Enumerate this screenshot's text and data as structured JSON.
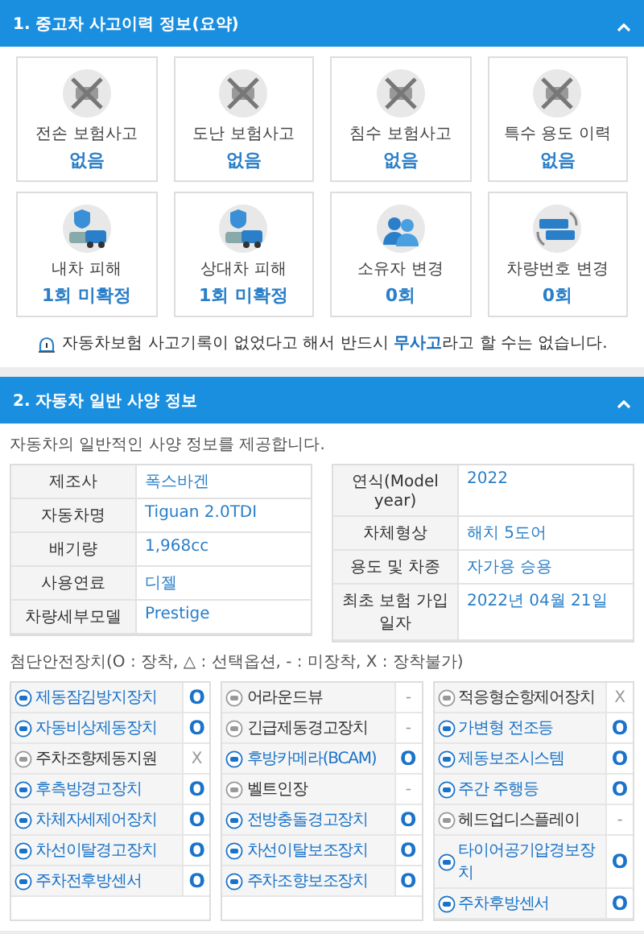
{
  "history": {
    "title": "1. 중고차 사고이력 정보(요약)",
    "expanded": true,
    "cards": [
      {
        "label": "전손 보험사고",
        "value": "없음",
        "kind": "none"
      },
      {
        "label": "도난 보험사고",
        "value": "없음",
        "kind": "none"
      },
      {
        "label": "침수 보험사고",
        "value": "없음",
        "kind": "none"
      },
      {
        "label": "특수 용도 이력",
        "value": "없음",
        "kind": "none"
      },
      {
        "label": "내차 피해",
        "value": "1회 미확정",
        "kind": "damage"
      },
      {
        "label": "상대차 피해",
        "value": "1회 미확정",
        "kind": "damage"
      },
      {
        "label": "소유자 변경",
        "value": "0회",
        "kind": "owner"
      },
      {
        "label": "차량번호 변경",
        "value": "0회",
        "kind": "plate"
      }
    ],
    "notice": "자동차보험 사고기록이 없었다고 해서 반드시 **무사고**라고 할 수는 없습니다."
  },
  "spec": {
    "title": "2. 자동차 일반 사양 정보",
    "expanded": true,
    "subtitle": "자동차의 일반적인 사양 정보를 제공합니다.",
    "left": [
      {
        "label": "제조사",
        "value": "폭스바겐"
      },
      {
        "label": "자동차명",
        "value": "Tiguan 2.0TDI"
      },
      {
        "label": "배기량",
        "value": "1,968cc"
      },
      {
        "label": "사용연료",
        "value": "디젤"
      },
      {
        "label": "차량세부모델",
        "value": "Prestige"
      }
    ],
    "right": [
      {
        "label": "연식(Model year)",
        "value": "2022"
      },
      {
        "label": "차체형상",
        "value": "해치 5도어"
      },
      {
        "label": "용도 및 차종",
        "value": "자가용  승용"
      },
      {
        "label": "최초 보험 가입일자",
        "value": "2022년 04월 21일"
      }
    ],
    "legend": "첨단안전장치(O : 장착, △ : 선택옵션, - : 미장착, X : 장착불가)",
    "options": [
      [
        {
          "name": "제동잠김방지장치",
          "mark": "O",
          "installed": true
        },
        {
          "name": "자동비상제동장치",
          "mark": "O",
          "installed": true
        },
        {
          "name": "주차조향제동지원",
          "mark": "X",
          "installed": false
        },
        {
          "name": "후측방경고장치",
          "mark": "O",
          "installed": true
        },
        {
          "name": "차체자세제어장치",
          "mark": "O",
          "installed": true
        },
        {
          "name": "차선이탈경고장치",
          "mark": "O",
          "installed": true
        },
        {
          "name": "주차전후방센서",
          "mark": "O",
          "installed": true
        }
      ],
      [
        {
          "name": "어라운드뷰",
          "mark": "-",
          "installed": false
        },
        {
          "name": "긴급제동경고장치",
          "mark": "-",
          "installed": false
        },
        {
          "name": "후방카메라(BCAM)",
          "mark": "O",
          "installed": true
        },
        {
          "name": "벨트인장",
          "mark": "-",
          "installed": false
        },
        {
          "name": "전방충돌경고장치",
          "mark": "O",
          "installed": true
        },
        {
          "name": "차선이탈보조장치",
          "mark": "O",
          "installed": true
        },
        {
          "name": "주차조향보조장치",
          "mark": "O",
          "installed": true
        }
      ],
      [
        {
          "name": "적응형순항제어장치",
          "mark": "X",
          "installed": false
        },
        {
          "name": "가변형 전조등",
          "mark": "O",
          "installed": true
        },
        {
          "name": "제동보조시스템",
          "mark": "O",
          "installed": true
        },
        {
          "name": "주간 주행등",
          "mark": "O",
          "installed": true
        },
        {
          "name": "헤드업디스플레이",
          "mark": "-",
          "installed": false
        },
        {
          "name": "타이어공기압경보장치",
          "mark": "O",
          "installed": true
        },
        {
          "name": "주차후방센서",
          "mark": "O",
          "installed": true
        }
      ]
    ]
  }
}
